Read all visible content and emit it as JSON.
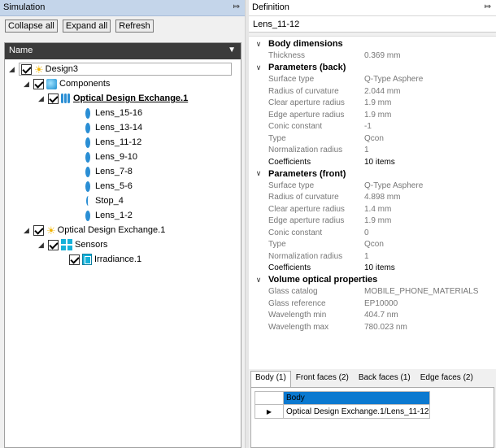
{
  "simulation": {
    "title": "Simulation",
    "toolbar": {
      "collapse": "Collapse all",
      "expand": "Expand all",
      "refresh": "Refresh"
    },
    "tree_header": "Name",
    "nodes": {
      "design": "Design3",
      "components": "Components",
      "ode1": "Optical Design Exchange.1",
      "lenses": [
        "Lens_15-16",
        "Lens_13-14",
        "Lens_11-12",
        "Lens_9-10",
        "Lens_7-8",
        "Lens_5-6",
        "Stop_4",
        "Lens_1-2"
      ],
      "ode2": "Optical Design Exchange.1",
      "sensors": "Sensors",
      "irradiance": "Irradiance.1"
    }
  },
  "definition": {
    "title": "Definition",
    "name": "Lens_11-12",
    "sections": {
      "body": {
        "title": "Body dimensions",
        "thickness_k": "Thickness",
        "thickness_v": "0.369 mm"
      },
      "back": {
        "title": "Parameters (back)",
        "rows": [
          [
            "Surface type",
            "Q-Type Asphere"
          ],
          [
            "Radius of curvature",
            "2.044 mm"
          ],
          [
            "Clear aperture radius",
            "1.9 mm"
          ],
          [
            "Edge aperture radius",
            "1.9 mm"
          ],
          [
            "Conic constant",
            "-1"
          ],
          [
            "Type",
            "Qcon"
          ],
          [
            "Normalization radius",
            "1"
          ],
          [
            "Coefficients",
            "10 items"
          ]
        ]
      },
      "front": {
        "title": "Parameters (front)",
        "rows": [
          [
            "Surface type",
            "Q-Type Asphere"
          ],
          [
            "Radius of curvature",
            "4.898 mm"
          ],
          [
            "Clear aperture radius",
            "1.4 mm"
          ],
          [
            "Edge aperture radius",
            "1.9 mm"
          ],
          [
            "Conic constant",
            "0"
          ],
          [
            "Type",
            "Qcon"
          ],
          [
            "Normalization radius",
            "1"
          ],
          [
            "Coefficients",
            "10 items"
          ]
        ]
      },
      "volume": {
        "title": "Volume optical properties",
        "rows": [
          [
            "Glass catalog",
            "MOBILE_PHONE_MATERIALS"
          ],
          [
            "Glass reference",
            "EP10000"
          ],
          [
            "Wavelength min",
            "404.7 nm"
          ],
          [
            "Wavelength max",
            "780.023 nm"
          ]
        ]
      }
    },
    "tabs": [
      "Body (1)",
      "Front faces (2)",
      "Back faces (1)",
      "Edge faces (2)"
    ],
    "table": {
      "header": "Body",
      "row": "Optical Design Exchange.1/Lens_11-12"
    }
  }
}
